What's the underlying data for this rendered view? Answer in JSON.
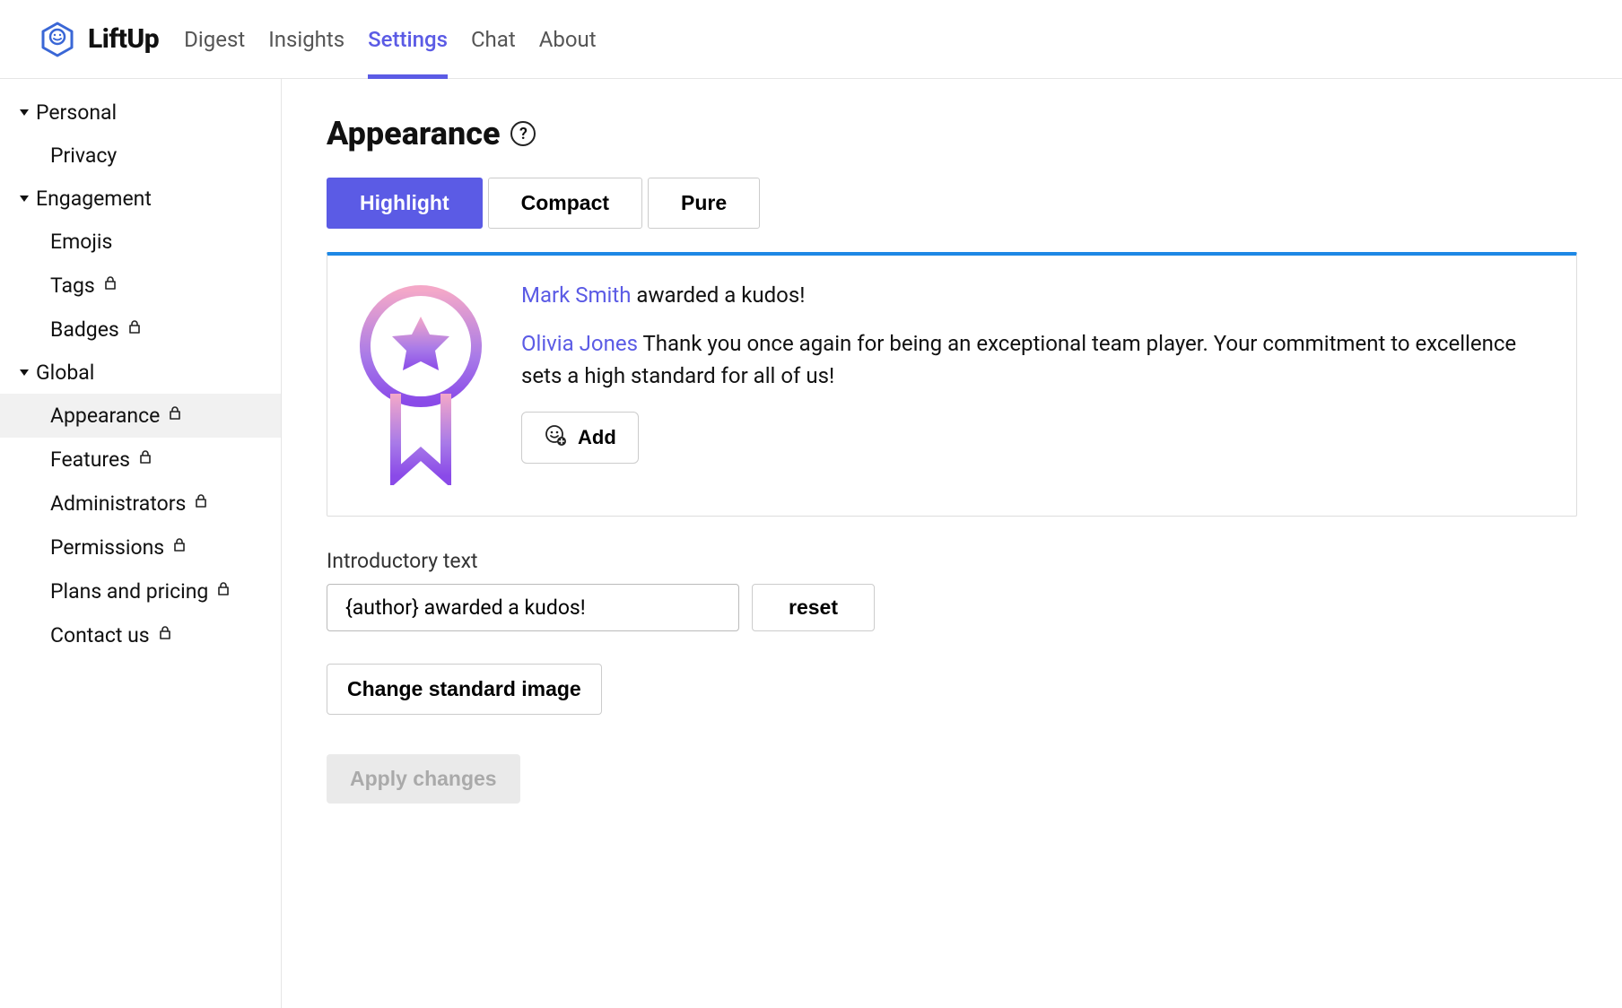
{
  "header": {
    "brand": "LiftUp",
    "nav": [
      "Digest",
      "Insights",
      "Settings",
      "Chat",
      "About"
    ],
    "active_index": 2
  },
  "sidebar": {
    "groups": [
      {
        "label": "Personal",
        "items": [
          {
            "label": "Privacy",
            "locked": false
          }
        ]
      },
      {
        "label": "Engagement",
        "items": [
          {
            "label": "Emojis",
            "locked": false
          },
          {
            "label": "Tags",
            "locked": true
          },
          {
            "label": "Badges",
            "locked": true
          }
        ]
      },
      {
        "label": "Global",
        "items": [
          {
            "label": "Appearance",
            "locked": true,
            "selected": true
          },
          {
            "label": "Features",
            "locked": true
          },
          {
            "label": "Administrators",
            "locked": true
          },
          {
            "label": "Permissions",
            "locked": true
          },
          {
            "label": "Plans and pricing",
            "locked": true
          },
          {
            "label": "Contact us",
            "locked": true
          }
        ]
      }
    ]
  },
  "main": {
    "title": "Appearance",
    "tabs": [
      "Highlight",
      "Compact",
      "Pure"
    ],
    "active_tab": 0,
    "preview": {
      "author": "Mark Smith",
      "author_suffix": " awarded a kudos!",
      "recipient": "Olivia Jones",
      "message": " Thank you once again for being an exceptional team player. Your commitment to excellence sets a high standard for all of us!",
      "add_label": "Add"
    },
    "intro_label": "Introductory text",
    "intro_value": "{author} awarded a kudos!",
    "reset_label": "reset",
    "change_image_label": "Change standard image",
    "apply_label": "Apply changes"
  }
}
